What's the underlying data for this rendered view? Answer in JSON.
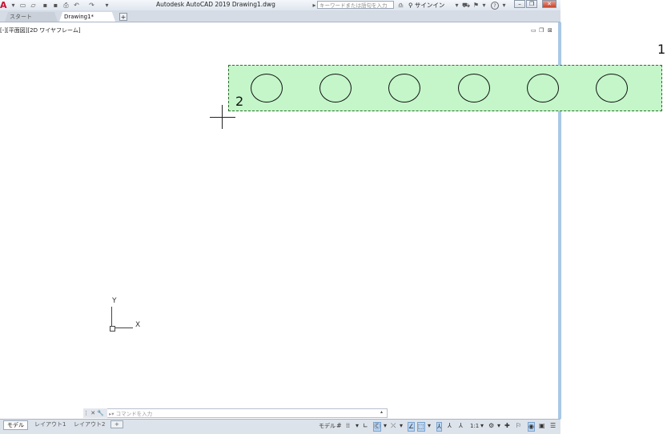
{
  "app": {
    "logo": "A",
    "title": "Autodesk AutoCAD 2019    Drawing1.dwg",
    "search_placeholder": "キーワードまたは語句を入力",
    "signin": "サインイン",
    "help": "?"
  },
  "tabs": [
    {
      "label": "スタート"
    },
    {
      "label": "Drawing1*"
    }
  ],
  "tab_add": "+",
  "viewport": {
    "label": "[-][平面図][2D ワイヤフレーム]"
  },
  "annotations": {
    "point1": "1",
    "point2": "2"
  },
  "ucs": {
    "x": "X",
    "y": "Y"
  },
  "command": {
    "placeholder": "コマンドを入力"
  },
  "layouts": [
    {
      "label": "モデル"
    },
    {
      "label": "レイアウト1"
    },
    {
      "label": "レイアウト2"
    }
  ],
  "layout_add": "+",
  "status": {
    "model": "モデル",
    "scale": "1:1"
  },
  "colors": {
    "selection_fill": "#c4f6c9",
    "selection_border": "#2f6e2f",
    "logo": "#c8102e"
  }
}
